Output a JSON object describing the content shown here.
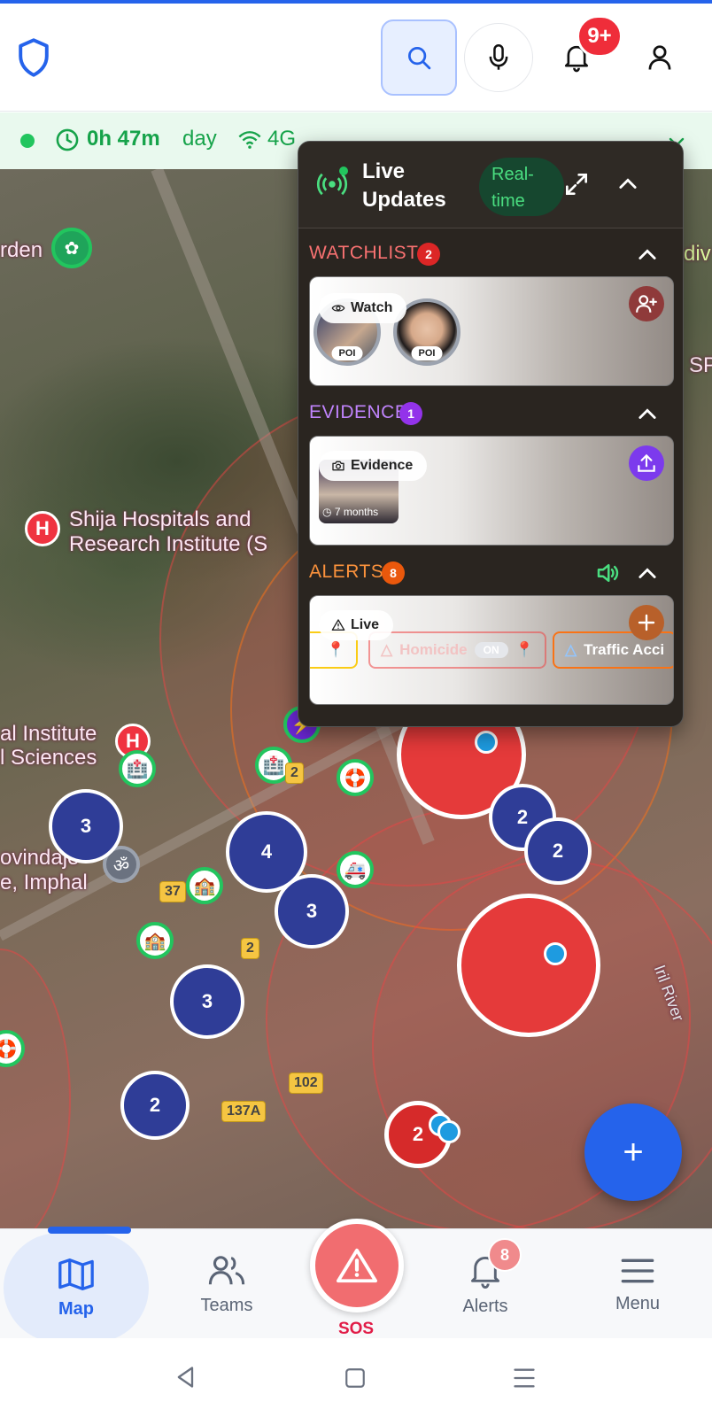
{
  "header": {
    "icons": [
      "shield-icon",
      "search-icon",
      "mic-icon",
      "bell-icon",
      "user-icon"
    ],
    "notification_count": "9+"
  },
  "status": {
    "session_time": "0h 47m",
    "mode": "day",
    "network": "4G"
  },
  "live_panel": {
    "title_line1": "Live",
    "title_line2": "Updates",
    "realtime_line1": "Real-",
    "realtime_line2": "time",
    "watchlist": {
      "label": "WATCHLIST",
      "count": "2",
      "chip": "Watch",
      "tag1": "POI",
      "tag2": "POI"
    },
    "evidence": {
      "label": "EVIDENCE",
      "count": "1",
      "chip": "Evidence",
      "thumb_time": "7 months"
    },
    "alerts": {
      "label": "ALERTS",
      "count": "8",
      "chip": "Live",
      "items": [
        "Homicide",
        "Traffic Acci"
      ],
      "item_badge": "ON"
    },
    "colors": {
      "watchlist": "#f87171",
      "evidence": "#c084fc",
      "alerts": "#fb923c"
    }
  },
  "map": {
    "labels": {
      "garden": "rden",
      "hospital_line1": "Shija Hospitals and",
      "hospital_line2": "Research Institute (S",
      "institute_line1": "al Institute",
      "institute_line2": "l Sciences",
      "govindaji_line1": "ovindaje",
      "govindaji_line2": "e, Imphal",
      "river": "Iril River",
      "right_edge_1": "div",
      "right_edge_2": "SP"
    },
    "clusters": [
      "3",
      "4",
      "3",
      "3",
      "2",
      "2",
      "2",
      "2"
    ],
    "red_cluster_label": "2",
    "routes": [
      "37",
      "2",
      "2",
      "102",
      "137A"
    ]
  },
  "fab_label": "+",
  "nav": {
    "map": "Map",
    "teams": "Teams",
    "sos": "SOS",
    "alerts": "Alerts",
    "alerts_badge": "8",
    "menu": "Menu"
  }
}
